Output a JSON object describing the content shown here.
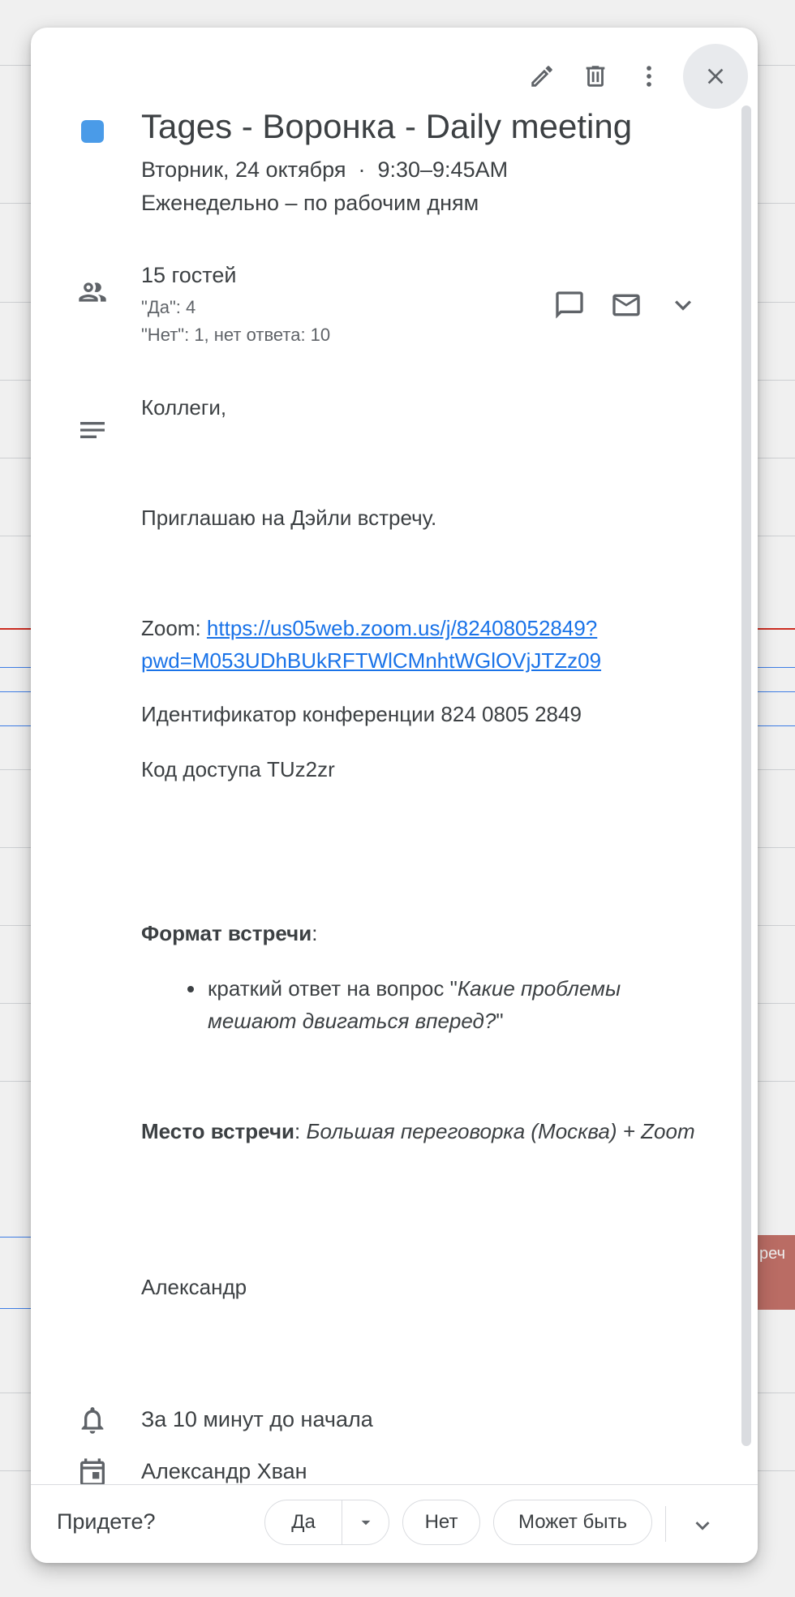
{
  "background": {
    "event_chip": "реч"
  },
  "toolbar": {
    "edit_icon": "pencil-icon",
    "delete_icon": "trash-icon",
    "more_icon": "more-vert-icon",
    "close_icon": "close-icon"
  },
  "event": {
    "color": "#4a9be8",
    "title": "Tages - Воронка - Daily meeting",
    "date_line": "Вторник, 24 октября  ·  9:30–9:45AM",
    "recurrence": "Еженедельно – по рабочим дням"
  },
  "guests": {
    "title": "15 гостей",
    "yes": "\"Да\": 4",
    "no_and_pending": "\"Нет\": 1, нет ответа: 10"
  },
  "description": {
    "greeting": "Коллеги,",
    "invite": "Приглашаю на Дэйли встречу.",
    "zoom_label": "Zoom: ",
    "zoom_link_line1": "https://us05web.zoom.us/j/82408052849?",
    "zoom_link_line2": "pwd=M053UDhBUkRFTWlCMnhtWGlOVjJTZz09",
    "conf_id": "Идентификатор конференции 824 0805 2849",
    "access_code": "Код доступа TUz2zr",
    "format_label": "Формат встречи",
    "colon": ":",
    "format_item_prefix": "краткий ответ на вопрос \"",
    "format_item_italic": "Какие проблемы мешают двигаться вперед?",
    "format_item_suffix": "\"",
    "place_label": "Место встречи",
    "place_value": "Большая переговорка (Москва) + Zoom",
    "signature": "Александр"
  },
  "notification": "За 10 минут до начала",
  "organizer": "Александр Хван",
  "footer": {
    "question": "Придете?",
    "yes": "Да",
    "no": "Нет",
    "maybe": "Может быть"
  }
}
